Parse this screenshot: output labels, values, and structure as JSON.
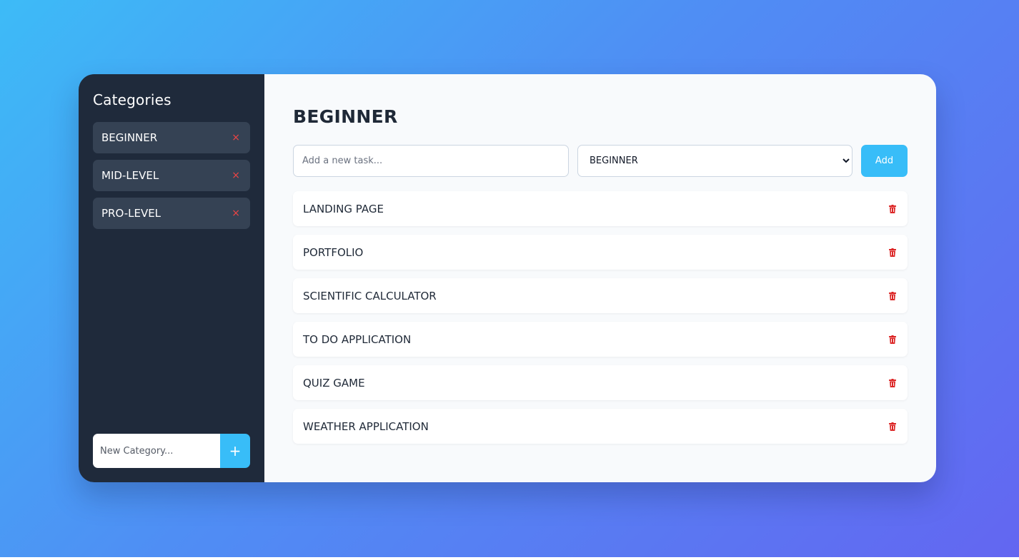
{
  "sidebar": {
    "title": "Categories",
    "items": [
      {
        "label": "BEGINNER",
        "remove": "×"
      },
      {
        "label": "MID-LEVEL",
        "remove": "×"
      },
      {
        "label": "PRO-LEVEL",
        "remove": "×"
      }
    ],
    "new_category_placeholder": "New Category...",
    "add_button": "+"
  },
  "main": {
    "title": "BEGINNER",
    "task_placeholder": "Add a new task...",
    "selected_category": "BEGINNER",
    "add_button": "Add",
    "tasks": [
      {
        "label": "LANDING PAGE"
      },
      {
        "label": "PORTFOLIO"
      },
      {
        "label": "SCIENTIFIC CALCULATOR"
      },
      {
        "label": "TO DO APPLICATION"
      },
      {
        "label": "QUIZ GAME"
      },
      {
        "label": "WEATHER APPLICATION"
      }
    ]
  },
  "icons": {
    "delete": "trash-icon",
    "remove": "close-icon",
    "add": "plus-icon"
  },
  "colors": {
    "sidebar_bg": "#1f2a3b",
    "sidebar_item_bg": "#354254",
    "accent": "#38bdf8",
    "danger": "#ef4444",
    "main_bg": "#f8fafc"
  }
}
